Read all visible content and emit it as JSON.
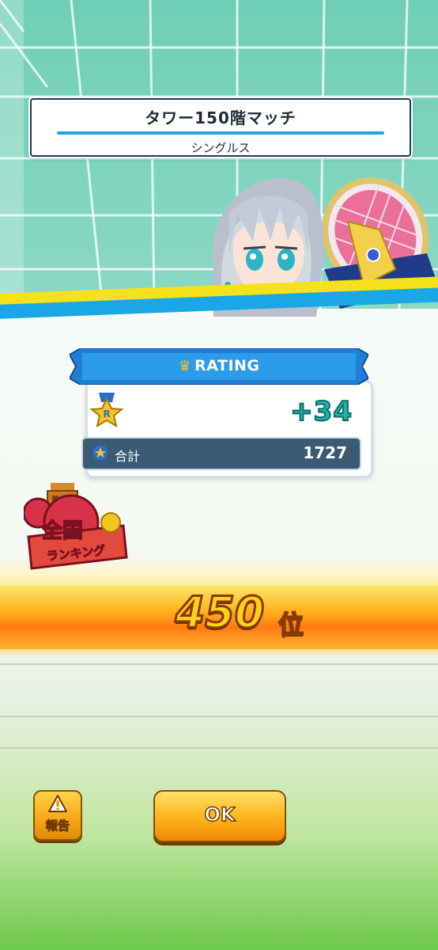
{
  "header": {
    "title": "タワー150階マッチ",
    "subtitle": "シングルス"
  },
  "rating": {
    "banner_label": "RATING",
    "banner_icon": "crown-icon",
    "medal_icon": "rating-medal-icon",
    "medal_letter": "R",
    "delta": "+34",
    "total_label": "合計",
    "total_value": "1727"
  },
  "ranking": {
    "badge_line1": "全国",
    "badge_line2": "ランキング",
    "rank_value": "450",
    "rank_unit": "位"
  },
  "buttons": {
    "report_label": "報告",
    "report_icon": "warning-icon",
    "ok_label": "OK"
  },
  "colors": {
    "accent_blue": "#1ca7df",
    "delta_green": "#18b6a8",
    "rank_gold": "#ffd21a",
    "button_orange": "#f7a614"
  }
}
